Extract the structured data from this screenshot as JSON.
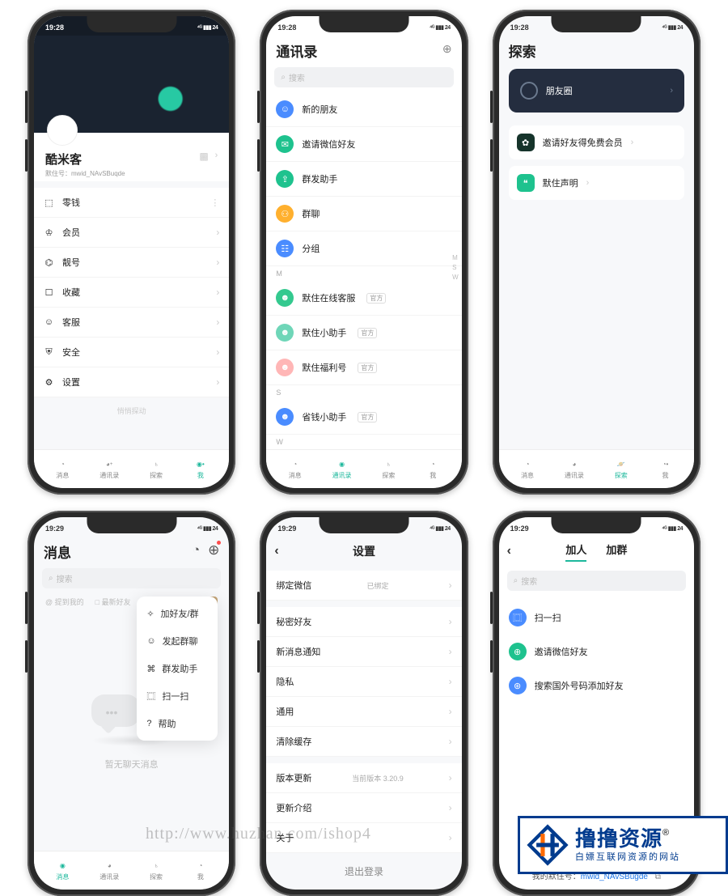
{
  "status_time1": "19:28",
  "status_time2": "19:29",
  "signal": "⁴ᴳ ▮▮▮ 24",
  "tabs": {
    "msg": "消息",
    "contacts": "通讯录",
    "discover": "探索",
    "me": "我"
  },
  "search_placeholder": "搜索",
  "profile": {
    "name": "酷米客",
    "id_label": "默住号：mwid_NAvSBuqde",
    "menu": [
      {
        "icon": "⬚",
        "label": "零钱"
      },
      {
        "icon": "♔",
        "label": "会员"
      },
      {
        "icon": "⌬",
        "label": "靓号"
      },
      {
        "icon": "☐",
        "label": "收藏"
      },
      {
        "icon": "☺",
        "label": "客服"
      },
      {
        "icon": "⛨",
        "label": "安全"
      },
      {
        "icon": "⚙",
        "label": "设置"
      }
    ],
    "more_label": "悄悄探动"
  },
  "contacts": {
    "title": "通讯录",
    "items": [
      {
        "color": "#4a8cff",
        "label": "新的朋友"
      },
      {
        "color": "#1ec28e",
        "label": "邀请微信好友"
      },
      {
        "color": "#1ec28e",
        "label": "群发助手"
      },
      {
        "color": "#ffb02e",
        "label": "群聊"
      },
      {
        "color": "#4a8cff",
        "label": "分组"
      }
    ],
    "section": "M",
    "list": [
      {
        "color": "#34c98f",
        "label": "默住在线客服",
        "tag": "官方"
      },
      {
        "color": "#6fd6b8",
        "label": "默住小助手",
        "tag": "官方"
      },
      {
        "color": "#ffb6b6",
        "label": "默住福利号",
        "tag": "官方"
      }
    ],
    "section2": "S",
    "list2": [
      {
        "color": "#4a8cff",
        "label": "省钱小助手",
        "tag": "官方"
      }
    ],
    "section3": "W",
    "alpha": [
      "M",
      "S",
      "W"
    ]
  },
  "discover": {
    "title": "探索",
    "moments": "朋友圈",
    "rows": [
      {
        "icon_bg": "#16342b",
        "label": "邀请好友得免费会员"
      },
      {
        "icon_bg": "#1ec28e",
        "label": "默住声明"
      }
    ]
  },
  "messages": {
    "title": "消息",
    "filters": [
      "@ 提到我的",
      "□ 最新好友"
    ],
    "popup": [
      {
        "icon": "✧",
        "label": "加好友/群"
      },
      {
        "icon": "☺",
        "label": "发起群聊"
      },
      {
        "icon": "⌘",
        "label": "群发助手"
      },
      {
        "icon": "⿴",
        "label": "扫一扫"
      },
      {
        "icon": "?",
        "label": "帮助"
      }
    ],
    "empty": "暂无聊天消息"
  },
  "settings": {
    "title": "设置",
    "rows": [
      {
        "label": "绑定微信",
        "sub": "已绑定"
      },
      {
        "label": "秘密好友"
      },
      {
        "label": "新消息通知"
      },
      {
        "label": "隐私"
      },
      {
        "label": "通用"
      },
      {
        "label": "清除缓存"
      },
      {
        "label": "版本更新",
        "sub": "当前版本 3.20.9"
      },
      {
        "label": "更新介绍"
      },
      {
        "label": "关于"
      }
    ],
    "logout": "退出登录"
  },
  "addfriend": {
    "tab1": "加人",
    "tab2": "加群",
    "rows": [
      {
        "color": "#4a8cff",
        "icon": "⿴",
        "label": "扫一扫"
      },
      {
        "color": "#1ec28e",
        "icon": "⊕",
        "label": "邀请微信好友"
      },
      {
        "color": "#4a8cff",
        "icon": "⊛",
        "label": "搜索国外号码添加好友"
      }
    ],
    "myid_label": "我的默住号：",
    "myid": "mwid_NAvSBugde"
  },
  "watermark": "http://www.huzhan.com/ishop4",
  "brand": {
    "name": "撸撸资源",
    "reg": "®",
    "slogan": "白嫖互联网资源的网站"
  }
}
